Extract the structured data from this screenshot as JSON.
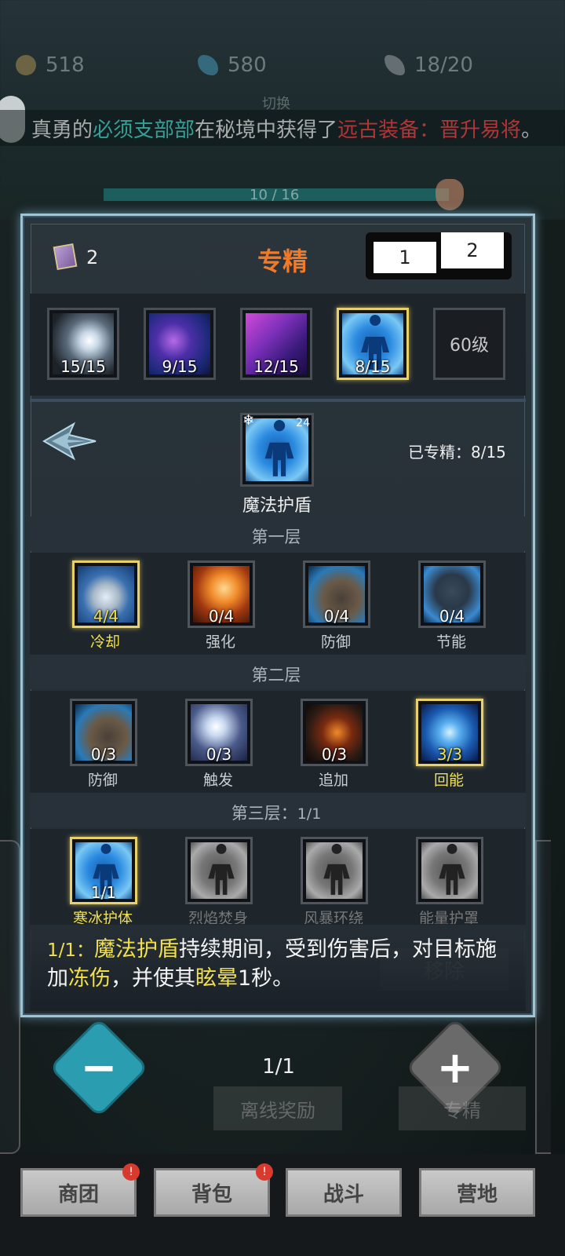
{
  "background": {
    "resources": [
      {
        "icon": "coin-icon",
        "value": "518"
      },
      {
        "icon": "gem-icon",
        "value": "580"
      },
      {
        "icon": "feather-icon",
        "value": "18/20"
      }
    ],
    "switch_label": "切换",
    "ticker": {
      "part1": "真勇的",
      "player": "必须支部部",
      "part2": "在秘境中获得了",
      "item": "远古装备：晋升易将",
      "part3": "。"
    },
    "hp_text": "10 / 16"
  },
  "panel": {
    "book_count": "2",
    "title": "专精",
    "tabs": [
      "1",
      "2"
    ],
    "specs": [
      {
        "count": "15/15",
        "icon": "light-orb-icon"
      },
      {
        "count": "9/15",
        "icon": "arcane-capsule-icon"
      },
      {
        "count": "12/15",
        "icon": "purple-strike-icon"
      },
      {
        "count": "8/15",
        "icon": "magic-shield-icon",
        "selected": true
      },
      {
        "locked_label": "60级"
      }
    ],
    "current": {
      "name": "魔法护盾",
      "badge": "24",
      "progress_label": "已专精：8/15"
    },
    "layers": [
      {
        "label": "第一层",
        "talents": [
          {
            "name": "冷却",
            "value": "4/4",
            "icon": "clock-icon",
            "maxed": true
          },
          {
            "name": "强化",
            "value": "0/4",
            "icon": "fist-fire-icon"
          },
          {
            "name": "防御",
            "value": "0/4",
            "icon": "round-shield-icon"
          },
          {
            "name": "节能",
            "value": "0/4",
            "icon": "helmet-icon"
          }
        ]
      },
      {
        "label": "第二层",
        "talents": [
          {
            "name": "防御",
            "value": "0/3",
            "icon": "round-shield-icon"
          },
          {
            "name": "触发",
            "value": "0/3",
            "icon": "lightning-hand-icon"
          },
          {
            "name": "追加",
            "value": "0/3",
            "icon": "gauntlet-icon"
          },
          {
            "name": "回能",
            "value": "3/3",
            "icon": "energy-slash-icon",
            "maxed": true
          }
        ]
      },
      {
        "label": "第三层：",
        "label_count": "1/1",
        "talents": [
          {
            "name": "寒冰护体",
            "value": "1/1",
            "icon": "ice-body-icon",
            "maxed": true
          },
          {
            "name": "烈焰焚身",
            "value": "",
            "icon": "flame-body-icon"
          },
          {
            "name": "风暴环绕",
            "value": "",
            "icon": "storm-body-icon"
          },
          {
            "name": "能量护罩",
            "value": "",
            "icon": "energy-body-icon"
          }
        ]
      }
    ],
    "description": {
      "count": "1/1：",
      "skill": "魔法护盾",
      "text1": "持续期间，受到伤害后，对目标施加",
      "effect1": "冻伤",
      "text2": "，并使其",
      "effect2": "眩晕",
      "text3": "1秒。"
    },
    "remove_label": "移除",
    "counter": "1/1"
  },
  "ghost_buttons": [
    "离线奖励",
    "专精"
  ],
  "nav": [
    {
      "label": "商团",
      "badge": "!"
    },
    {
      "label": "背包",
      "badge": "!"
    },
    {
      "label": "战斗"
    },
    {
      "label": "营地"
    }
  ],
  "colors": {
    "title": "#f07a28",
    "gold": "#f2e04a",
    "minus_button": "#2a9db0",
    "panel_border": "#9fc4d4"
  }
}
